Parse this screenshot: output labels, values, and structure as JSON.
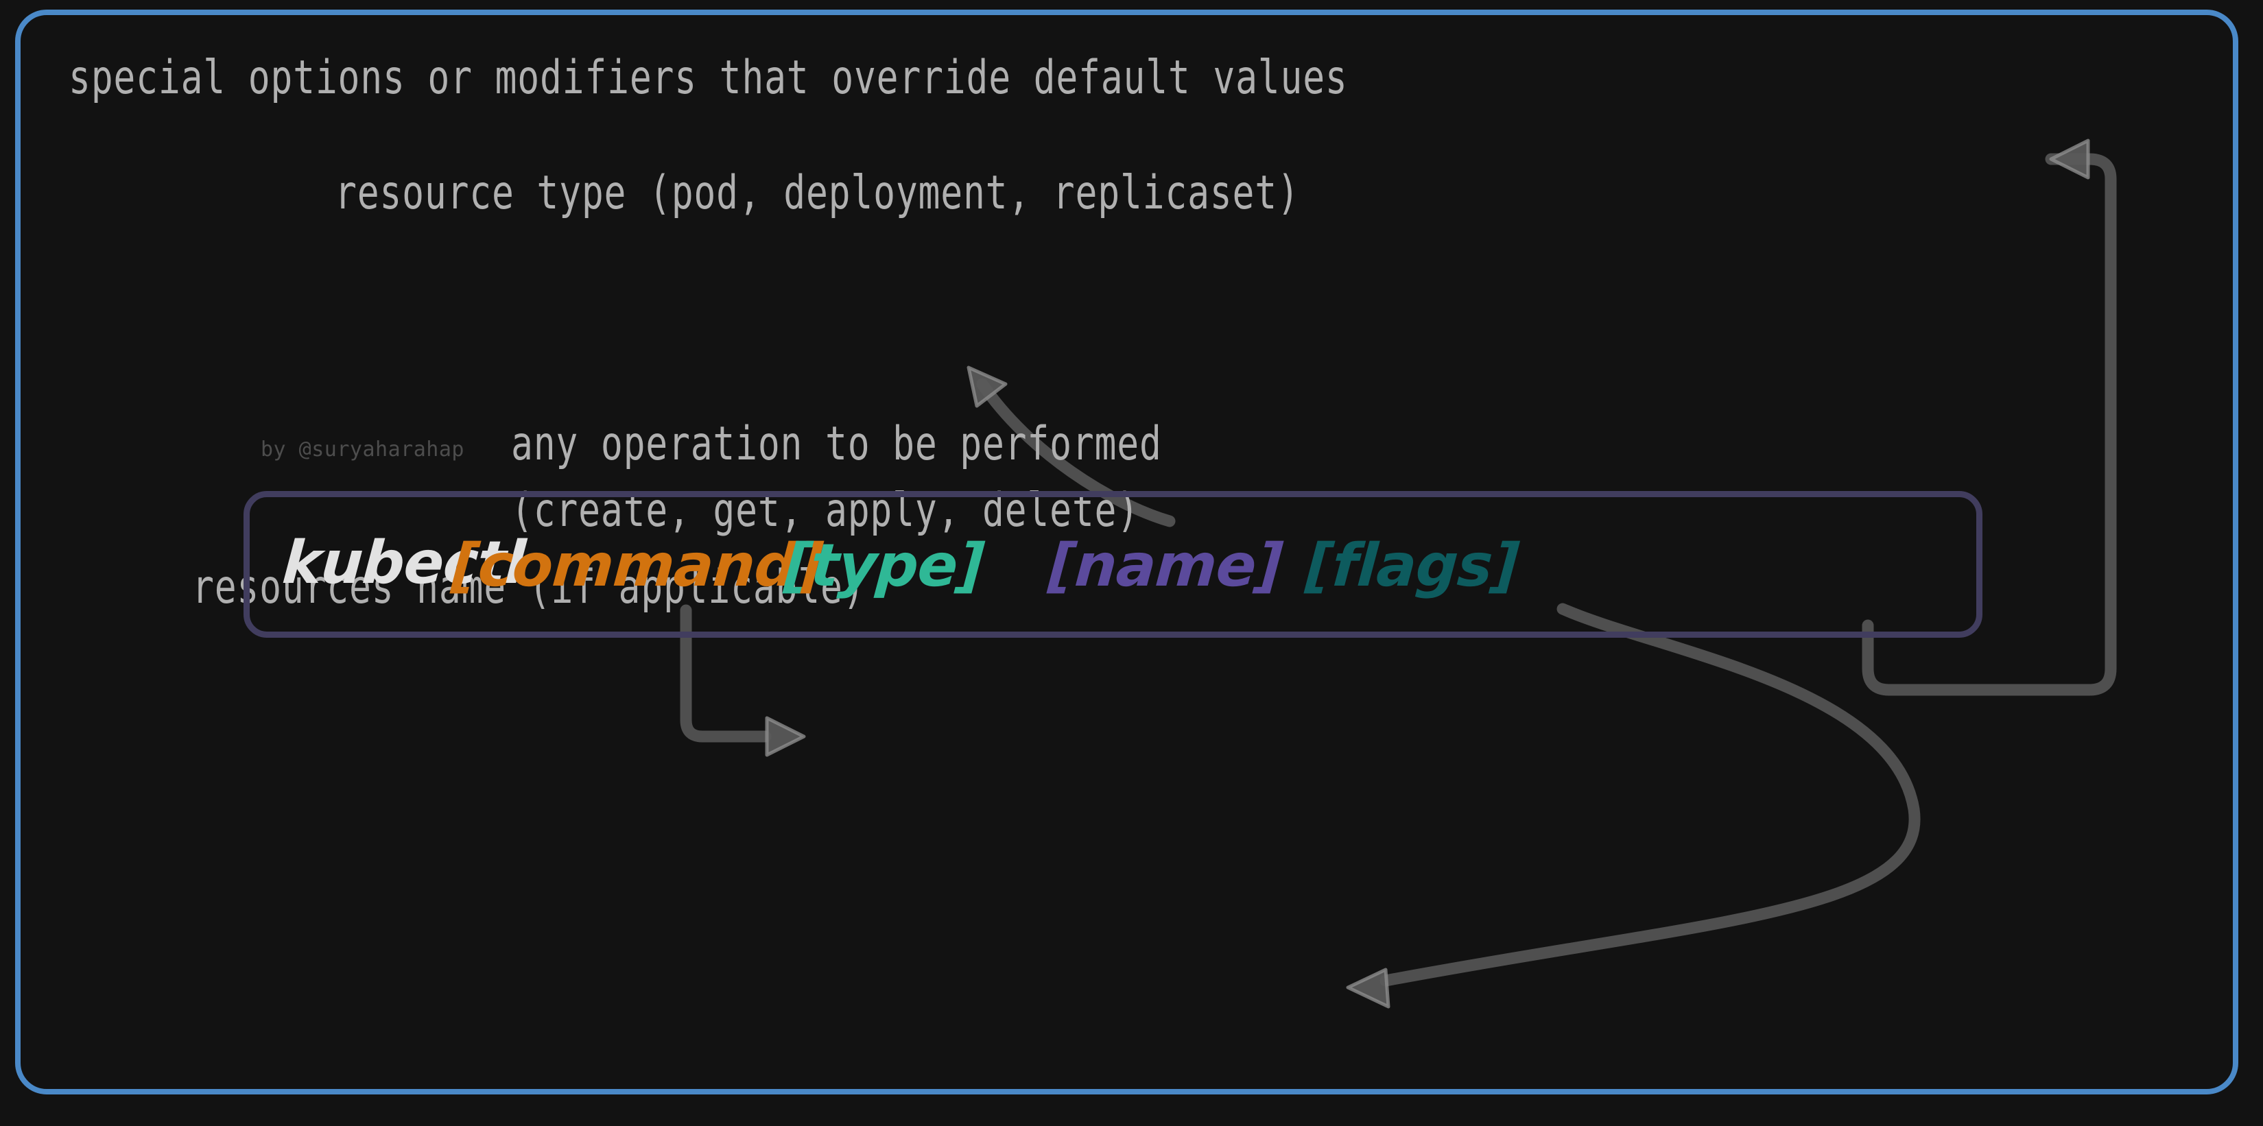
{
  "frame": {
    "border_color": "#4a89c8",
    "background": "#121212"
  },
  "watermark": {
    "text": "by @suryaharahap",
    "color": "#4d4d4d"
  },
  "command_box": {
    "border_color": "#413d5e",
    "tokens": [
      {
        "id": "kubectl",
        "label": "kubectl",
        "color": "#e2e2e2"
      },
      {
        "id": "command",
        "label": "[command]",
        "color": "#d2730f"
      },
      {
        "id": "type",
        "label": "[type]",
        "color": "#2fb896"
      },
      {
        "id": "name",
        "label": "[name]",
        "color": "#5b4a9c"
      },
      {
        "id": "flags",
        "label": "[flags]",
        "color": "#0d5b5e"
      }
    ]
  },
  "annotations": {
    "flags": {
      "text": "special options or modifiers that override default values",
      "target": "flags",
      "color": "#b0b0b0"
    },
    "type": {
      "text": "resource type (pod, deployment, replicaset)",
      "target": "type",
      "color": "#b0b0b0"
    },
    "command": {
      "text": "any operation to be performed\n(create, get, apply, delete)",
      "target": "command",
      "color": "#b0b0b0"
    },
    "name": {
      "text": "resources name (if applicable)",
      "target": "name",
      "color": "#b0b0b0"
    }
  },
  "arrows": {
    "stroke_color": "#4f4f4f",
    "head_color": "#5a5a5a",
    "items": [
      {
        "id": "arrow-flags",
        "from": "flags-token",
        "to": "flags-annotation"
      },
      {
        "id": "arrow-type",
        "from": "type-token",
        "to": "type-annotation"
      },
      {
        "id": "arrow-command",
        "from": "command-token",
        "to": "command-annotation"
      },
      {
        "id": "arrow-name",
        "from": "name-token",
        "to": "name-annotation"
      }
    ]
  }
}
